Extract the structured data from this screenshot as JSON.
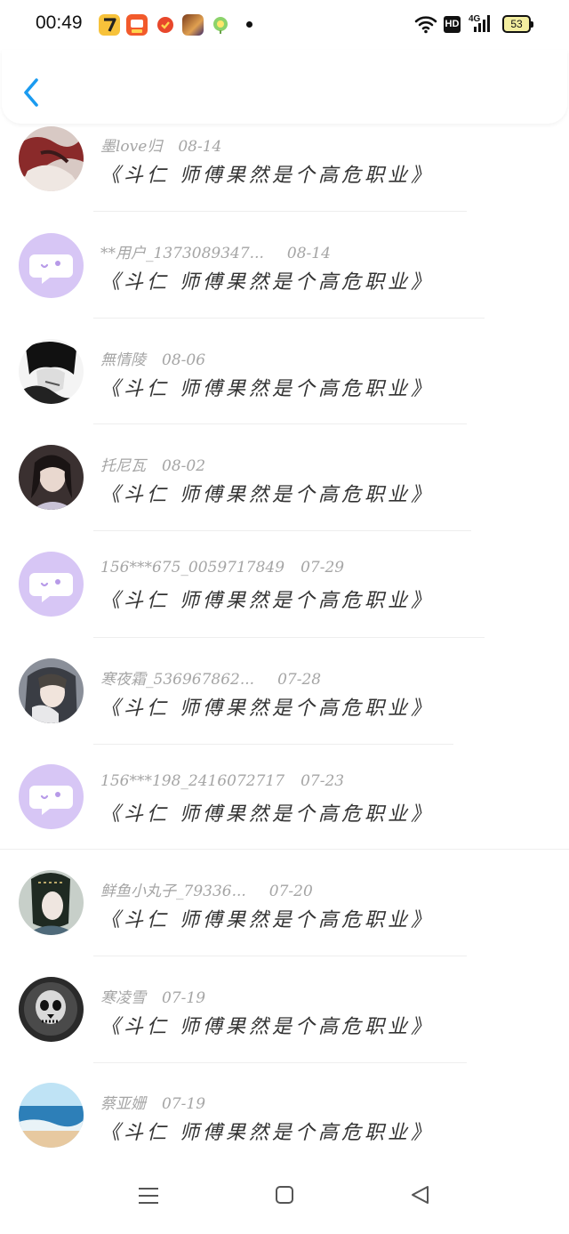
{
  "status_bar": {
    "time": "00:49",
    "network": "4G",
    "hd_label": "HD",
    "battery": "53"
  },
  "header": {
    "back_icon": "chevron-left-icon"
  },
  "comments": [
    {
      "name": "墨love归",
      "date": "08-14",
      "text": "《斗仁 师傅果然是个高危职业》",
      "avatar": "photo"
    },
    {
      "name": "**用户_1373089347...",
      "date": "08-14",
      "text": "《斗仁 师傅果然是个高危职业》",
      "avatar": "default-chat-icon"
    },
    {
      "name": "無情陵",
      "date": "08-06",
      "text": "《斗仁 师傅果然是个高危职业》",
      "avatar": "photo"
    },
    {
      "name": "托尼瓦",
      "date": "08-02",
      "text": "《斗仁 师傅果然是个高危职业》",
      "avatar": "photo"
    },
    {
      "name": "156***675_0059717849",
      "date": "07-29",
      "text": "《斗仁 师傅果然是个高危职业》",
      "avatar": "default-chat-icon"
    },
    {
      "name": "寒夜霜_536967862...",
      "date": "07-28",
      "text": "《斗仁 师傅果然是个高危职业》",
      "avatar": "photo"
    },
    {
      "name": "156***198_2416072717",
      "date": "07-23",
      "text": "《斗仁 师傅果然是个高危职业》",
      "avatar": "default-chat-icon"
    },
    {
      "name": "鲜鱼小丸子_79336...",
      "date": "07-20",
      "text": "《斗仁 师傅果然是个高危职业》",
      "avatar": "photo"
    },
    {
      "name": "寒凌雪",
      "date": "07-19",
      "text": "《斗仁 师傅果然是个高危职业》",
      "avatar": "photo"
    },
    {
      "name": "蔡亚姗",
      "date": "07-19",
      "text": "《斗仁 师傅果然是个高危职业》",
      "avatar": "photo"
    }
  ],
  "colors": {
    "accent": "#1a9bf0",
    "default_avatar_bg": "#d7c6f5",
    "meta_text": "#a5a5a5"
  },
  "nav": {
    "icons": [
      "menu-icon",
      "home-square-icon",
      "back-triangle-icon"
    ]
  }
}
